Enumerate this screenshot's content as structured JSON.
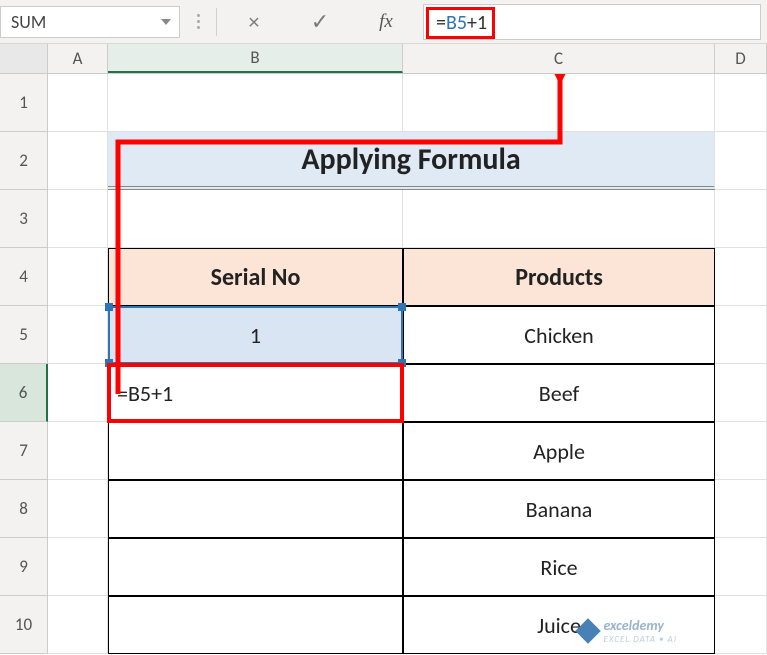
{
  "nameBox": {
    "value": "SUM"
  },
  "formulaBar": {
    "cancel_icon": "×",
    "confirm_icon": "✓",
    "fx_label": "fx",
    "formula_prefix": "=",
    "formula_ref": "B5",
    "formula_suffix": "+1"
  },
  "columnHeaders": {
    "A": "A",
    "B": "B",
    "C": "C",
    "D": "D"
  },
  "rowHeaders": [
    "1",
    "2",
    "3",
    "4",
    "5",
    "6",
    "7",
    "8",
    "9",
    "10"
  ],
  "sheet": {
    "title": "Applying Formula",
    "headers": {
      "serial": "Serial No",
      "products": "Products"
    },
    "rows": [
      {
        "serial": "1",
        "product": "Chicken"
      },
      {
        "serial": "=B5+1",
        "product": "Beef",
        "editing": true
      },
      {
        "serial": "",
        "product": "Apple"
      },
      {
        "serial": "",
        "product": "Banana"
      },
      {
        "serial": "",
        "product": "Rice"
      },
      {
        "serial": "",
        "product": "Juice"
      }
    ]
  },
  "watermark": {
    "text": "exceldemy",
    "subtext": "EXCEL DATA • AI"
  },
  "chart_data": {
    "type": "table",
    "title": "Applying Formula",
    "columns": [
      "Serial No",
      "Products"
    ],
    "rows": [
      [
        "1",
        "Chicken"
      ],
      [
        "=B5+1",
        "Beef"
      ],
      [
        "",
        "Apple"
      ],
      [
        "",
        "Banana"
      ],
      [
        "",
        "Rice"
      ],
      [
        "",
        "Juice"
      ]
    ],
    "formula_bar": "=B5+1",
    "active_cell": "B6",
    "referenced_cell": "B5"
  }
}
